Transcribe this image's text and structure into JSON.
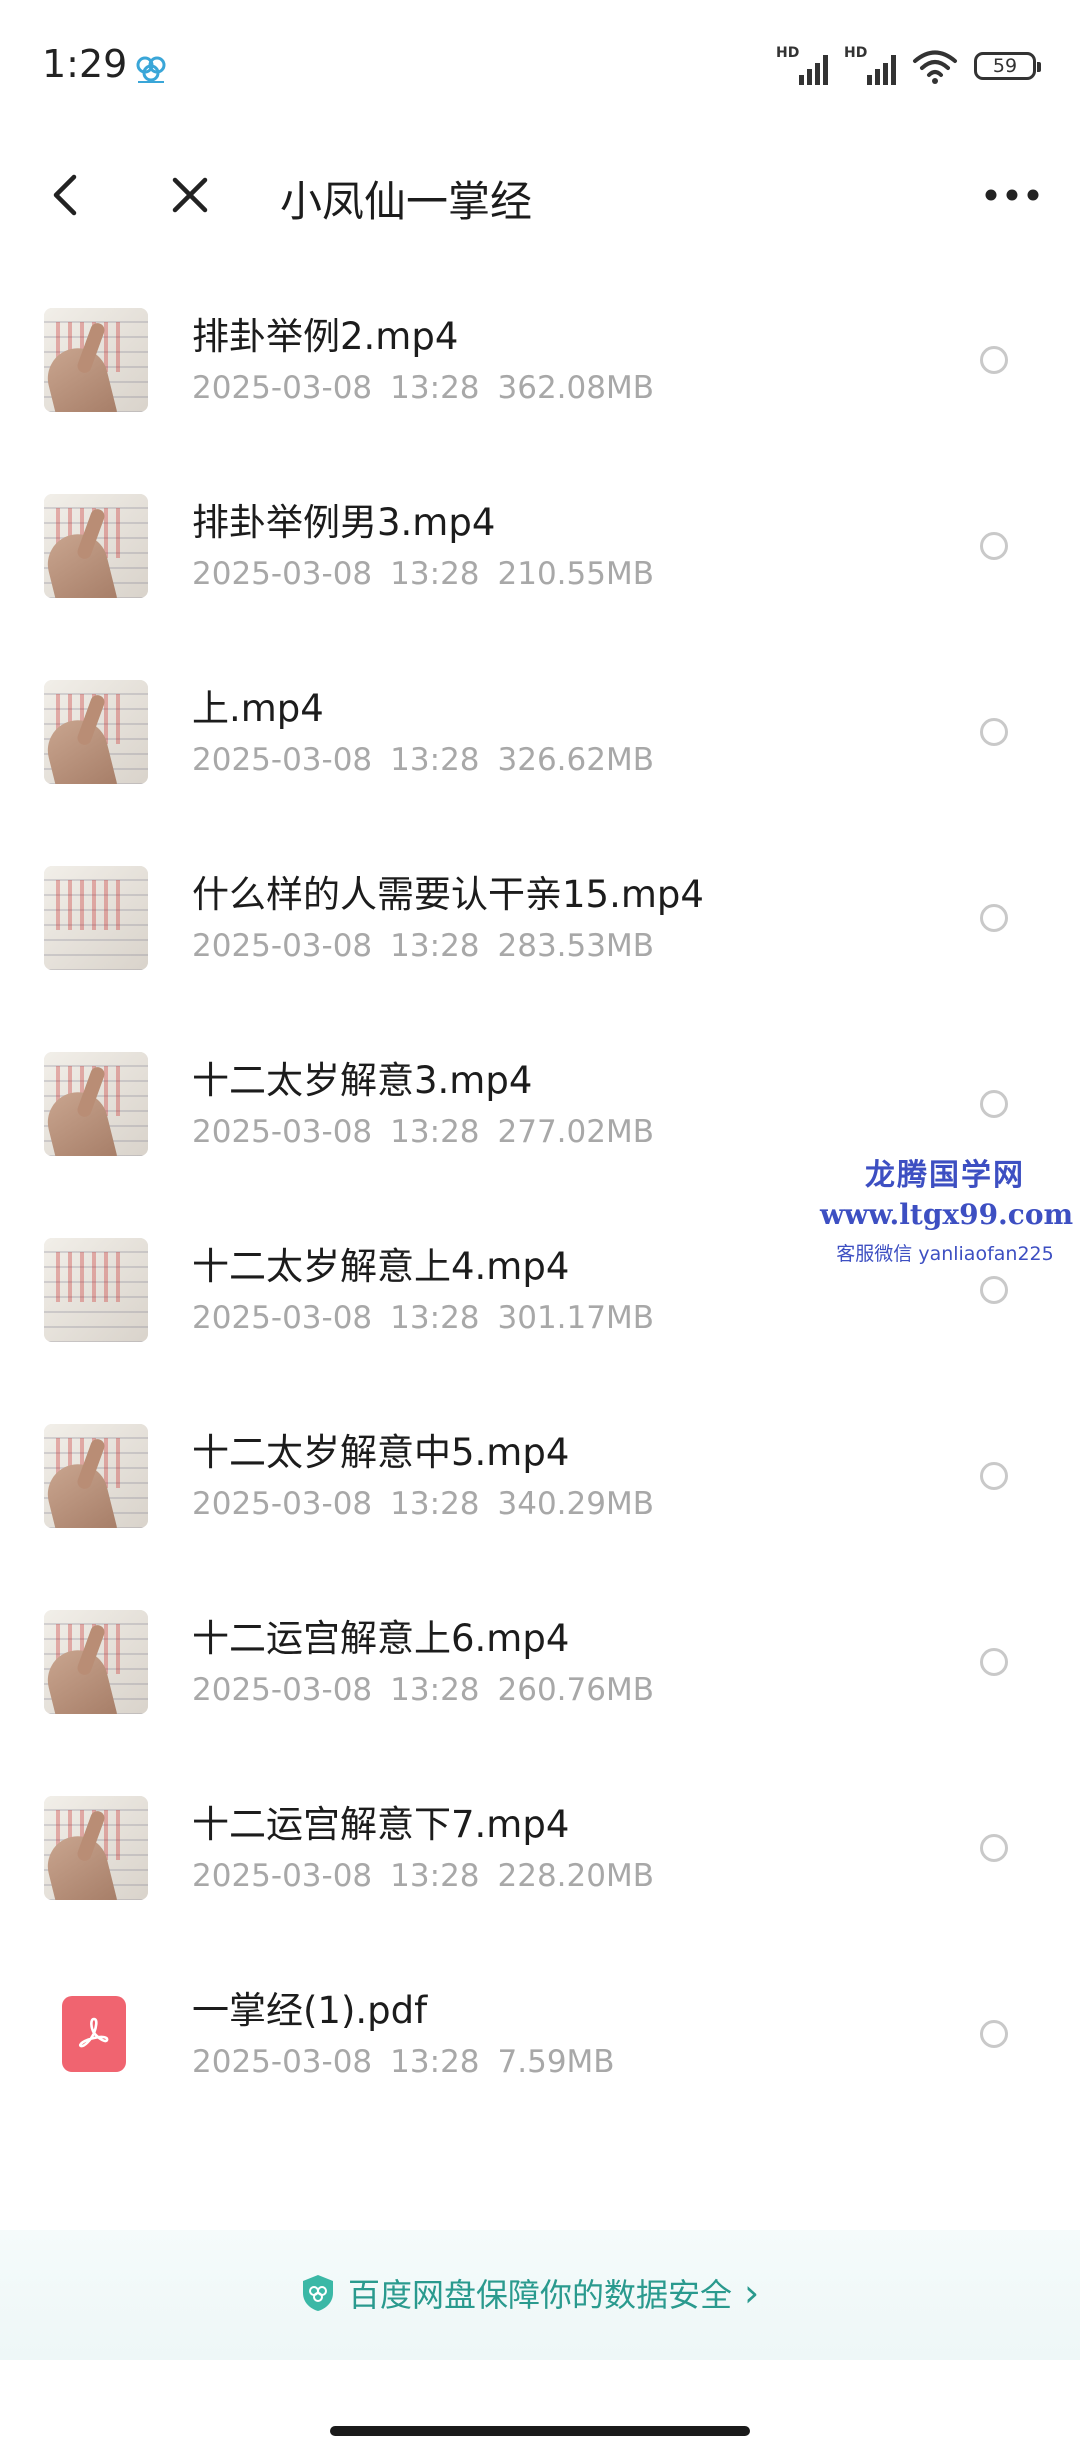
{
  "status_bar": {
    "time": "1:29",
    "hd1": "HD",
    "hd2": "HD",
    "battery": "59"
  },
  "header": {
    "title": "小凤仙一掌经"
  },
  "files": [
    {
      "name": "排卦举例2.mp4",
      "date": "2025-03-08",
      "time": "13:28",
      "size": "362.08MB",
      "type": "video"
    },
    {
      "name": "排卦举例男3.mp4",
      "date": "2025-03-08",
      "time": "13:28",
      "size": "210.55MB",
      "type": "video"
    },
    {
      "name": "上.mp4",
      "date": "2025-03-08",
      "time": "13:28",
      "size": "326.62MB",
      "type": "video"
    },
    {
      "name": "什么样的人需要认干亲15.mp4",
      "date": "2025-03-08",
      "time": "13:28",
      "size": "283.53MB",
      "type": "video"
    },
    {
      "name": "十二太岁解意3.mp4",
      "date": "2025-03-08",
      "time": "13:28",
      "size": "277.02MB",
      "type": "video"
    },
    {
      "name": "十二太岁解意上4.mp4",
      "date": "2025-03-08",
      "time": "13:28",
      "size": "301.17MB",
      "type": "video"
    },
    {
      "name": "十二太岁解意中5.mp4",
      "date": "2025-03-08",
      "time": "13:28",
      "size": "340.29MB",
      "type": "video"
    },
    {
      "name": "十二运宫解意上6.mp4",
      "date": "2025-03-08",
      "time": "13:28",
      "size": "260.76MB",
      "type": "video"
    },
    {
      "name": "十二运宫解意下7.mp4",
      "date": "2025-03-08",
      "time": "13:28",
      "size": "228.20MB",
      "type": "video"
    },
    {
      "name": "一掌经(1).pdf",
      "date": "2025-03-08",
      "time": "13:28",
      "size": "7.59MB",
      "type": "pdf"
    }
  ],
  "watermark": {
    "title": "龙腾国学网",
    "url": "www.ltgx99.com",
    "contact": "客服微信 yanliaofan225"
  },
  "footer": {
    "security_text": "百度网盘保障你的数据安全",
    "chevron": "›"
  },
  "colors": {
    "accent": "#2a9a8e",
    "pdf": "#f06470",
    "watermark": "#3d4fc2"
  }
}
